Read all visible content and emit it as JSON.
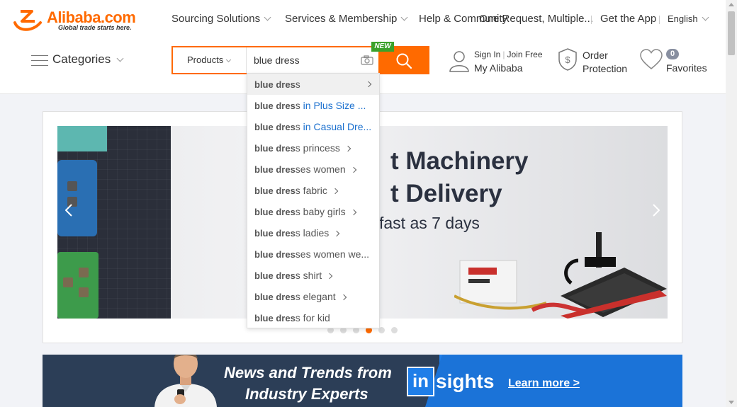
{
  "brand": {
    "logo_text": "Alibaba.com",
    "tagline": "Global trade starts here.",
    "accent_color": "#ff6a00"
  },
  "topnav": {
    "sourcing": "Sourcing Solutions",
    "services": "Services & Membership",
    "help": "Help & Community",
    "overlay_text": "One Request, Multiple...",
    "get_app": "Get the App",
    "language": "English"
  },
  "categories_label": "Categories",
  "search": {
    "category": "Products",
    "query": "blue dress",
    "new_badge": "NEW"
  },
  "account": {
    "sign_in": "Sign In",
    "join_free": "Join Free",
    "my_alibaba": "My Alibaba",
    "order_line1": "Order",
    "order_line2": "Protection",
    "favorites_count": "0",
    "favorites_label": "Favorites"
  },
  "suggestions": [
    {
      "match": "blue dres",
      "rest": "s",
      "extra": "",
      "arrow": "right-edge"
    },
    {
      "match": "blue dres",
      "rest": "s",
      "extra": " in Plus Size ...",
      "arrow": ""
    },
    {
      "match": "blue dres",
      "rest": "s",
      "extra": " in Casual Dre...",
      "arrow": ""
    },
    {
      "match": "blue dres",
      "rest": "s princess",
      "extra": "",
      "arrow": "inline"
    },
    {
      "match": "blue dres",
      "rest": "ses women",
      "extra": "",
      "arrow": "inline"
    },
    {
      "match": "blue dres",
      "rest": "s fabric",
      "extra": "",
      "arrow": "inline"
    },
    {
      "match": "blue dres",
      "rest": "s baby girls",
      "extra": "",
      "arrow": "inline"
    },
    {
      "match": "blue dres",
      "rest": "s ladies",
      "extra": "",
      "arrow": "inline"
    },
    {
      "match": "blue dres",
      "rest": "ses women we...",
      "extra": "",
      "arrow": ""
    },
    {
      "match": "blue dres",
      "rest": "s shirt",
      "extra": "",
      "arrow": "inline"
    },
    {
      "match": "blue dres",
      "rest": "s elegant",
      "extra": "",
      "arrow": "inline"
    },
    {
      "match": "blue dres",
      "rest": "s for kid",
      "extra": "",
      "arrow": ""
    }
  ],
  "banner": {
    "headline_1": "t Machinery",
    "headline_2": "t Delivery",
    "subline": "fast as 7 days",
    "slide_count": 6,
    "active_slide": 4
  },
  "insights": {
    "title_1": "News and Trends from",
    "title_2": "Industry Experts",
    "logo_in": "in",
    "logo_sights": "sights",
    "learn_more": "Learn more >"
  }
}
